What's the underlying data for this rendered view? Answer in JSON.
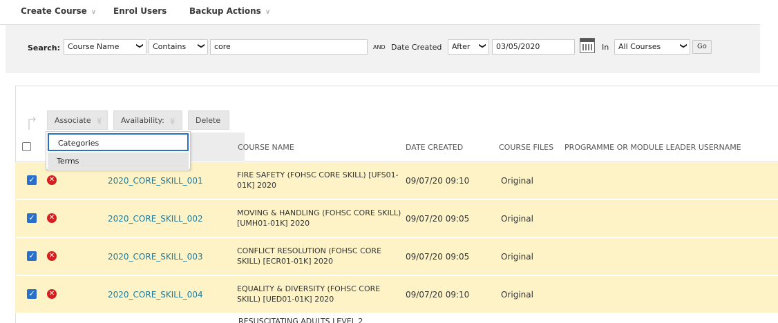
{
  "action_bar": {
    "create_course": "Create Course",
    "enrol_users": "Enrol Users",
    "backup_actions": "Backup Actions",
    "chevron": "∨"
  },
  "search": {
    "label": "Search:",
    "field_value": "Course Name",
    "operator_value": "Contains",
    "query_value": "core",
    "and_label": "AND",
    "date_label": "Date Created",
    "date_operator_value": "After",
    "date_value": "03/05/2020",
    "in_label": "In",
    "scope_value": "All Courses",
    "go_label": "Go",
    "arrow": "❯"
  },
  "bulk": {
    "associate_label": "Associate",
    "availability_label": "Availability:",
    "delete_label": "Delete",
    "chevron": "≫"
  },
  "associate_menu": {
    "items": [
      "Categories",
      "Terms"
    ]
  },
  "table": {
    "headers": {
      "course_name": "COURSE NAME",
      "date_created": "DATE CREATED",
      "course_files": "COURSE FILES",
      "leader": "PROGRAMME OR MODULE LEADER USERNAME"
    },
    "rows": [
      {
        "id": "2020_CORE_SKILL_001",
        "name": "FIRE SAFETY (FOHSC CORE SKILL) [UFS01-01K] 2020",
        "date": "09/07/20 09:10",
        "files": "Original"
      },
      {
        "id": "2020_CORE_SKILL_002",
        "name": "MOVING & HANDLING (FOHSC CORE SKILL) [UMH01-01K] 2020",
        "date": "09/07/20 09:05",
        "files": "Original"
      },
      {
        "id": "2020_CORE_SKILL_003",
        "name": "CONFLICT RESOLUTION (FOHSC CORE SKILL) [ECR01-01K] 2020",
        "date": "09/07/20 09:05",
        "files": "Original"
      },
      {
        "id": "2020_CORE_SKILL_004",
        "name": "EQUALITY & DIVERSITY (FOHSC CORE SKILL) [UED01-01K] 2020",
        "date": "09/07/20 09:10",
        "files": "Original"
      }
    ],
    "partial_row_name": "RESUSCITATING ADULTS LEVEL 2"
  },
  "colors": {
    "selected_row": "#fdf3c7",
    "link": "#1f7a9a",
    "checkbox": "#2a6fc9",
    "delete_icon": "#d62020"
  }
}
